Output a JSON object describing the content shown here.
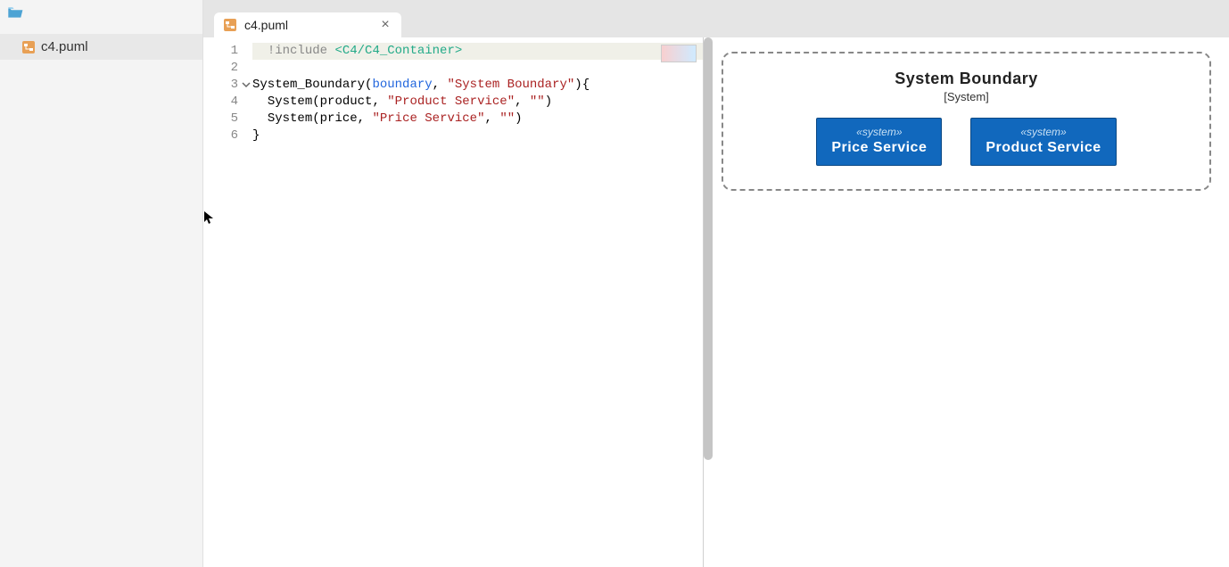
{
  "sidebar": {
    "file_name": "c4.puml"
  },
  "tabs": [
    {
      "title": "c4.puml"
    }
  ],
  "editor": {
    "lines": [
      1,
      2,
      3,
      4,
      5,
      6
    ],
    "code": {
      "l1_include": "!include",
      "l1_path": "<C4/C4_Container>",
      "l3_fn": "System_Boundary",
      "l3_arg1": "boundary",
      "l3_str": "\"System Boundary\"",
      "l3_tail": "){",
      "l4_fn": "System",
      "l4_arg1": "product",
      "l4_str1": "\"Product Service\"",
      "l4_str2": "\"\"",
      "l5_fn": "System",
      "l5_arg1": "price",
      "l5_str1": "\"Price Service\"",
      "l5_str2": "\"\"",
      "l6": "}"
    }
  },
  "diagram": {
    "boundary_title": "System Boundary",
    "boundary_sub": "[System]",
    "stereo": "«system»",
    "box1": "Price Service",
    "box2": "Product Service"
  }
}
